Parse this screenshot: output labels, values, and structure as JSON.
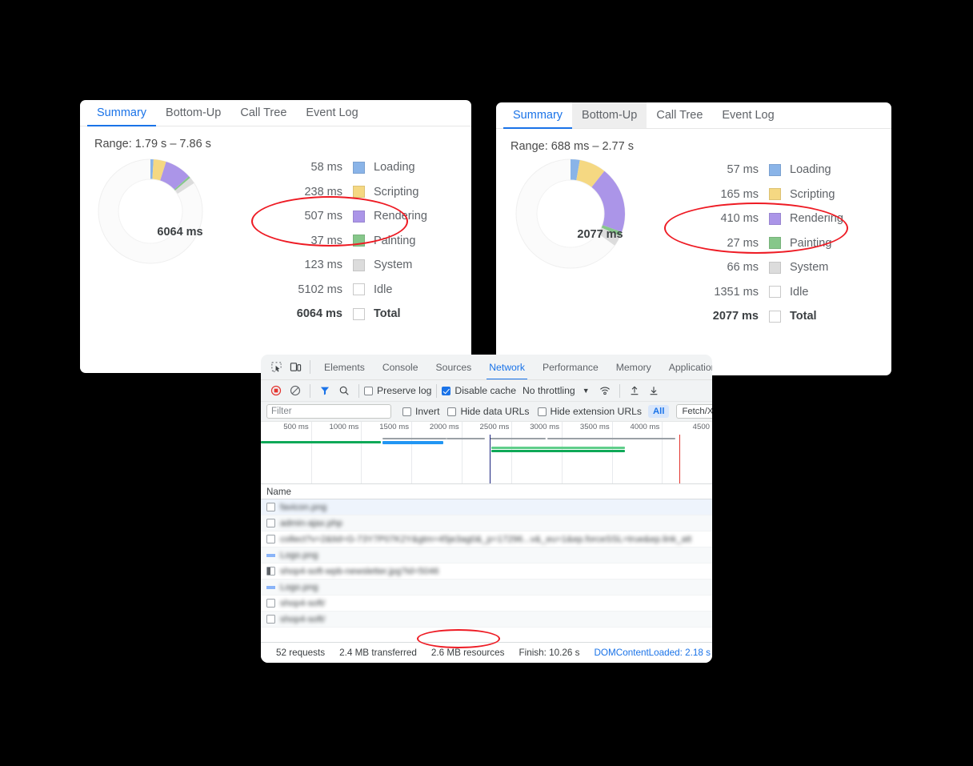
{
  "colors": {
    "loading": "#8AB4E8",
    "scripting": "#F5D882",
    "rendering": "#AB95E8",
    "painting": "#86C78A",
    "system": "#DCDCDC",
    "idle": "#FFFFFF",
    "accent": "#1A73E8",
    "annotation": "#EE1B24"
  },
  "perf_left": {
    "tabs": [
      {
        "label": "Summary",
        "state": "active"
      },
      {
        "label": "Bottom-Up",
        "state": "normal"
      },
      {
        "label": "Call Tree",
        "state": "normal"
      },
      {
        "label": "Event Log",
        "state": "normal"
      }
    ],
    "range": "Range: 1.79 s – 7.86 s",
    "donut_center": "6064 ms",
    "chart_data": {
      "type": "pie",
      "title": "Range: 1.79 s – 7.86 s",
      "categories": [
        "Loading",
        "Scripting",
        "Rendering",
        "Painting",
        "System",
        "Idle"
      ],
      "values": [
        58,
        238,
        507,
        37,
        123,
        5102
      ],
      "unit": "ms",
      "total": 6064,
      "total_label": "6064 ms",
      "legend_position": "right"
    },
    "legend": [
      {
        "value": "58 ms",
        "name": "Loading",
        "swatch": "loading"
      },
      {
        "value": "238 ms",
        "name": "Scripting",
        "swatch": "scripting"
      },
      {
        "value": "507 ms",
        "name": "Rendering",
        "swatch": "rendering"
      },
      {
        "value": "37 ms",
        "name": "Painting",
        "swatch": "painting"
      },
      {
        "value": "123 ms",
        "name": "System",
        "swatch": "system"
      },
      {
        "value": "5102 ms",
        "name": "Idle",
        "swatch": "idle"
      },
      {
        "value": "6064 ms",
        "name": "Total",
        "swatch": "idle"
      }
    ]
  },
  "perf_right": {
    "tabs": [
      {
        "label": "Summary",
        "state": "active"
      },
      {
        "label": "Bottom-Up",
        "state": "hover"
      },
      {
        "label": "Call Tree",
        "state": "normal"
      },
      {
        "label": "Event Log",
        "state": "normal"
      }
    ],
    "range": "Range: 688 ms – 2.77 s",
    "donut_center": "2077 ms",
    "chart_data": {
      "type": "pie",
      "title": "Range: 688 ms – 2.77 s",
      "categories": [
        "Loading",
        "Scripting",
        "Rendering",
        "Painting",
        "System",
        "Idle"
      ],
      "values": [
        57,
        165,
        410,
        27,
        66,
        1351
      ],
      "unit": "ms",
      "total": 2077,
      "total_label": "2077 ms",
      "legend_position": "right"
    },
    "legend": [
      {
        "value": "57 ms",
        "name": "Loading",
        "swatch": "loading"
      },
      {
        "value": "165 ms",
        "name": "Scripting",
        "swatch": "scripting"
      },
      {
        "value": "410 ms",
        "name": "Rendering",
        "swatch": "rendering"
      },
      {
        "value": "27 ms",
        "name": "Painting",
        "swatch": "painting"
      },
      {
        "value": "66 ms",
        "name": "System",
        "swatch": "system"
      },
      {
        "value": "1351 ms",
        "name": "Idle",
        "swatch": "idle"
      },
      {
        "value": "2077 ms",
        "name": "Total",
        "swatch": "idle"
      }
    ]
  },
  "devtools": {
    "tabs": [
      {
        "label": "Elements",
        "state": "normal"
      },
      {
        "label": "Console",
        "state": "normal"
      },
      {
        "label": "Sources",
        "state": "normal"
      },
      {
        "label": "Network",
        "state": "active"
      },
      {
        "label": "Performance",
        "state": "normal"
      },
      {
        "label": "Memory",
        "state": "normal"
      },
      {
        "label": "Application",
        "state": "normal"
      }
    ],
    "toolbar": {
      "record_icon": "record-stop-icon",
      "clear_icon": "clear-icon",
      "filter_icon": "filter-icon",
      "search_icon": "search-icon",
      "preserve_log": {
        "label": "Preserve log",
        "checked": false
      },
      "disable_cache": {
        "label": "Disable cache",
        "checked": true
      },
      "throttling": "No throttling",
      "throttling_caret": "chevron-down-icon",
      "wifi_icon": "network-conditions-icon",
      "import_icon": "import-har-icon",
      "export_icon": "export-har-icon"
    },
    "filterbar": {
      "filter_placeholder": "Filter",
      "filter_value": "",
      "invert": {
        "label": "Invert",
        "checked": false
      },
      "hide_data_urls": {
        "label": "Hide data URLs",
        "checked": false
      },
      "hide_extension_urls": {
        "label": "Hide extension URLs",
        "checked": false
      },
      "type_all": "All",
      "type_fetch_xhr": "Fetch/XHR"
    },
    "overview": {
      "ticks": [
        "500 ms",
        "1000 ms",
        "1500 ms",
        "2000 ms",
        "2500 ms",
        "3000 ms",
        "3500 ms",
        "4000 ms",
        "4500"
      ]
    },
    "table": {
      "column": "Name",
      "rows": [
        {
          "name": "favicon.png",
          "icon": "document-icon"
        },
        {
          "name": "admin-ajax.php",
          "icon": "document-icon"
        },
        {
          "name": "collect?v=2&tid=G-73Y7P07K2Y&gtm=45je3ag0&_p=17296...v&_eu=1&ep.forceSSL=true&ep.link_att",
          "icon": "document-icon"
        },
        {
          "name": "Logo.png",
          "icon": "image-icon"
        },
        {
          "name": "shop4-soft-wpb-newsletter.jpg?id=5046",
          "icon": "image-doc-icon"
        },
        {
          "name": "Logo.png",
          "icon": "image-icon"
        },
        {
          "name": "shop4-soft/",
          "icon": "document-icon"
        },
        {
          "name": "shop4-soft/",
          "icon": "document-icon"
        }
      ]
    },
    "status": {
      "requests": "52 requests",
      "transferred": "2.4 MB transferred",
      "resources": "2.6 MB resources",
      "finish": "Finish: 10.26 s",
      "dom_content_loaded": "DOMContentLoaded: 2.18 s"
    }
  }
}
